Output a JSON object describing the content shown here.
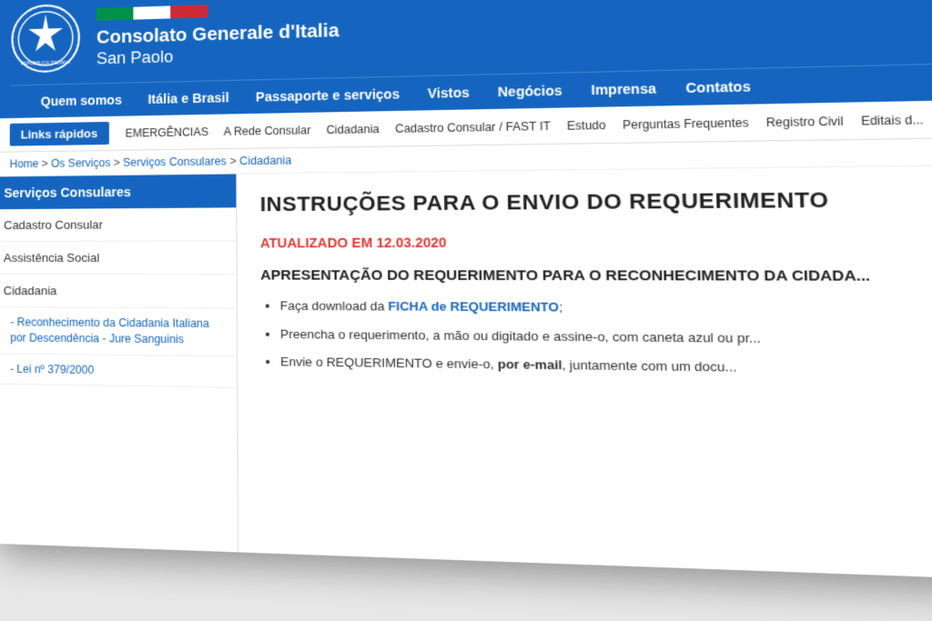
{
  "header": {
    "org_name": "Consolato Generale d'Italia",
    "org_sub": "San Paolo"
  },
  "main_nav": {
    "items": [
      {
        "label": "Quem somos"
      },
      {
        "label": "Itália e Brasil"
      },
      {
        "label": "Passaporte e serviços"
      },
      {
        "label": "Vistos"
      },
      {
        "label": "Negócios"
      },
      {
        "label": "Imprensa"
      },
      {
        "label": "Contatos"
      }
    ]
  },
  "secondary_nav": {
    "links_rapidos_label": "Links rápidos",
    "items": [
      {
        "label": "EMERGÊNCIAS"
      },
      {
        "label": "A Rede Consular"
      },
      {
        "label": "Cidadania"
      },
      {
        "label": "Cadastro Consular / FAST IT"
      },
      {
        "label": "Estudo"
      },
      {
        "label": "Perguntas Frequentes"
      },
      {
        "label": "Registro Civil"
      },
      {
        "label": "Editais d..."
      }
    ]
  },
  "breadcrumb": {
    "items": [
      {
        "label": "Home"
      },
      {
        "label": "Os Serviços"
      },
      {
        "label": "Serviços Consulares"
      },
      {
        "label": "Cidadania"
      }
    ]
  },
  "sidebar": {
    "title": "Serviços Consulares",
    "items": [
      {
        "label": "Cadastro Consular",
        "type": "item"
      },
      {
        "label": "Assistência Social",
        "type": "item"
      },
      {
        "label": "Cidadania",
        "type": "item"
      },
      {
        "label": "- Reconhecimento da Cidadania Italiana por Descendência - Jure Sanguinis",
        "type": "sub"
      },
      {
        "label": "- Lei nº 379/2000",
        "type": "sub"
      }
    ]
  },
  "main": {
    "page_title": "INSTRUÇÕES PARA O ENVIO DO REQUERIMENTO",
    "updated_date": "ATUALIZADO EM 12.03.2020",
    "section_heading": "APRESENTAÇÃO DO REQUERIMENTO PARA O RECONHECIMENTO DA CIDADA...",
    "bullets": [
      {
        "text": "Faça download da ",
        "link": "FICHA de REQUERIMENTO",
        "suffix": ";"
      },
      {
        "text": "Preencha o requerimento, a mão ou digitado e assine-o, com caneta azul ou pr..."
      },
      {
        "text": "Envie o REQUERIMENTO e envie-o, ",
        "bold": "por e-mail",
        "suffix": ", juntamente com um docu..."
      }
    ]
  }
}
